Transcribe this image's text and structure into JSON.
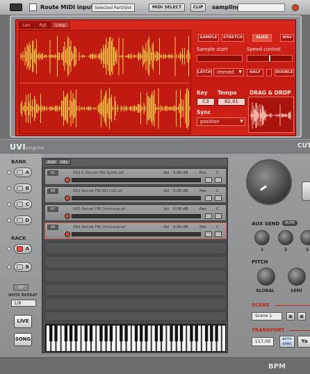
{
  "topbar": {
    "route_label": "Route MIDI input to:",
    "route_select": "Selected Part/Slot",
    "midi_select_btn": "MIDI SELECT",
    "clip_btn": "CLIP",
    "mode_label": "sampling"
  },
  "sampler": {
    "tabs": [
      "Lev",
      "Rgt",
      "Loop"
    ],
    "buttons": {
      "sample": "SAMPLE",
      "stretch": "STRETCH",
      "slice": "SLICE",
      "wav": "WAV"
    },
    "sample_start_label": "Sample start",
    "speed_control_label": "Speed control",
    "latch_label": "LATCH",
    "latch_mode": "Immed",
    "half_label": "HALF",
    "double_label": "DOUBLE",
    "key_label": "Key",
    "key_value": "C3",
    "tempo_label": "Tempo",
    "tempo_value": "82,01",
    "sync_label": "Sync",
    "sync_value": "position",
    "drag_drop_label": "DRAG & DROP"
  },
  "brand": {
    "name": "UVI",
    "suffix": "engine"
  },
  "left": {
    "bank_label": "BANK",
    "bank_letters": [
      "A",
      "B",
      "C",
      "D"
    ],
    "rack_label": "RACK",
    "rack_letters": [
      "A",
      "B"
    ],
    "sp_label": "SP",
    "note_repeat_label": "NOTE REPEAT",
    "note_repeat_value": "1/8",
    "live_btn": "LIVE",
    "song_btn": "SONG"
  },
  "parts": {
    "add_label": "ADD",
    "del_label": "DEL",
    "items": [
      {
        "num": "A1",
        "name": "062-C-Secret FBI Synth.aif",
        "vol_label": "Vol",
        "vol": "0,00 dB",
        "pan_label": "Pan",
        "pan": "C"
      },
      {
        "num": "A6",
        "name": "062-Secret FBI BD+SD.aif",
        "vol_label": "Vol",
        "vol": "0,00 dB",
        "pan_label": "Pan",
        "pan": "C"
      },
      {
        "num": "A7",
        "name": "062-Secret FBI DrmLoop.aif",
        "vol_label": "Vol",
        "vol": "0,00 dB",
        "pan_label": "Pan",
        "pan": "C"
      },
      {
        "num": "A8",
        "name": "062-Secret FBI DrmLoop.aif",
        "vol_label": "Vol",
        "vol": "0,00 dB",
        "pan_label": "Pan",
        "pan": "C"
      }
    ]
  },
  "right": {
    "cutoff_label": "CUTOFF",
    "aux_send_label": "AUX SEND",
    "aux_tag": "MUTE",
    "aux_nums": [
      "1",
      "2",
      "3"
    ],
    "pitch_label": "PITCH",
    "global_label": "GLOBAL",
    "semi_label": "SEMI",
    "scene_label": "SCENE",
    "scene_value": "Scene 1",
    "transport_label": "TRANSPORT",
    "bpm_value": "117,00",
    "auto_sync_label": "AUTO SYNC",
    "tap_label": "Ya"
  },
  "bottom": {
    "bpm_label": "BPM"
  },
  "colors": {
    "accent_red": "#d22419",
    "panel_gray": "#8a8c8e"
  }
}
